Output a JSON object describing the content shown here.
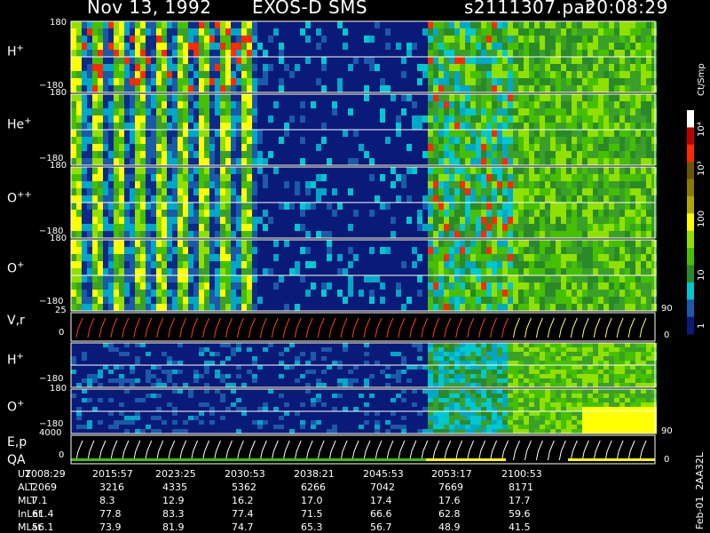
{
  "header": {
    "date": "Nov 13, 1992",
    "instrument": "EXOS-D SMS",
    "file": "s2111307.par",
    "time": "20:08:29"
  },
  "colorbar": {
    "unit": "Ct/Smp",
    "ticks": [
      "10⁴",
      "10³",
      "100",
      "10",
      "1"
    ],
    "stops": [
      "#ffffff",
      "#c00000",
      "#ff2a00",
      "#6b5500",
      "#8a7a00",
      "#b0a800",
      "#ffff00",
      "#90e000",
      "#44c000",
      "#2a8a2a",
      "#00c8d0",
      "#1a5aa8",
      "#0a1a78"
    ]
  },
  "panels": [
    {
      "label": "H",
      "sup": "+",
      "ytop": "180",
      "ybot": "−180"
    },
    {
      "label": "He",
      "sup": "+",
      "ytop": "180",
      "ybot": "−180"
    },
    {
      "label": "O",
      "sup": "++",
      "ytop": "180",
      "ybot": "−180"
    },
    {
      "label": "O",
      "sup": "+",
      "ytop": "180",
      "ybot": "−180"
    },
    {
      "label": "V,r",
      "sup": "",
      "ytop": "25",
      "ybot": "0",
      "right_top": "90",
      "right_bot": "0"
    },
    {
      "label": "H",
      "sup": "+",
      "ytop": "180",
      "ybot": "−180"
    },
    {
      "label": "O",
      "sup": "+",
      "ytop": "180",
      "ybot": "−180",
      "right_bot": "90"
    },
    {
      "label": "E,p",
      "label2": "QA",
      "sup": "",
      "ytop": "4000",
      "ybot": "0",
      "right_bot": "0"
    }
  ],
  "ephemeris": {
    "rows": [
      {
        "name": "UT",
        "values": [
          "2008:29",
          "2015:57",
          "2023:25",
          "2030:53",
          "2038:21",
          "2045:53",
          "2053:17",
          "2100:53"
        ]
      },
      {
        "name": "ALT",
        "values": [
          "2069",
          "3216",
          "4335",
          "5362",
          "6266",
          "7042",
          "7669",
          "8171"
        ]
      },
      {
        "name": "MLT",
        "values": [
          "7.1",
          "8.3",
          "12.9",
          "16.2",
          "17.0",
          "17.4",
          "17.6",
          "17.7"
        ]
      },
      {
        "name": "InLat",
        "values": [
          "61.4",
          "77.8",
          "83.3",
          "77.4",
          "71.5",
          "66.6",
          "62.8",
          "59.6"
        ]
      },
      {
        "name": "MLat",
        "values": [
          "56.1",
          "73.9",
          "81.9",
          "74.7",
          "65.3",
          "56.7",
          "48.9",
          "41.5"
        ]
      }
    ]
  },
  "footer_id": "Feb-01  2AA32L",
  "chart_data": {
    "type": "heatmap",
    "title": "Nov 13, 1992  EXOS-D SMS  s2111307.par  20:08:29",
    "x_time_labels": [
      "2008:29",
      "2015:57",
      "2023:25",
      "2030:53",
      "2038:21",
      "2045:53",
      "2053:17",
      "2100:53"
    ],
    "colorbar_range": [
      "1",
      "10⁴"
    ],
    "colorbar_unit": "Ct/Smp",
    "series": [
      {
        "name": "H+",
        "ylim": [
          -180,
          180
        ]
      },
      {
        "name": "He+",
        "ylim": [
          -180,
          180
        ]
      },
      {
        "name": "O++",
        "ylim": [
          -180,
          180
        ]
      },
      {
        "name": "O+",
        "ylim": [
          -180,
          180
        ]
      },
      {
        "name": "V,r",
        "ylim": [
          0,
          25
        ]
      },
      {
        "name": "H+",
        "ylim": [
          -180,
          180
        ]
      },
      {
        "name": "O+",
        "ylim": [
          -180,
          180
        ]
      },
      {
        "name": "E,p",
        "ylim": [
          0,
          4000
        ]
      }
    ]
  }
}
